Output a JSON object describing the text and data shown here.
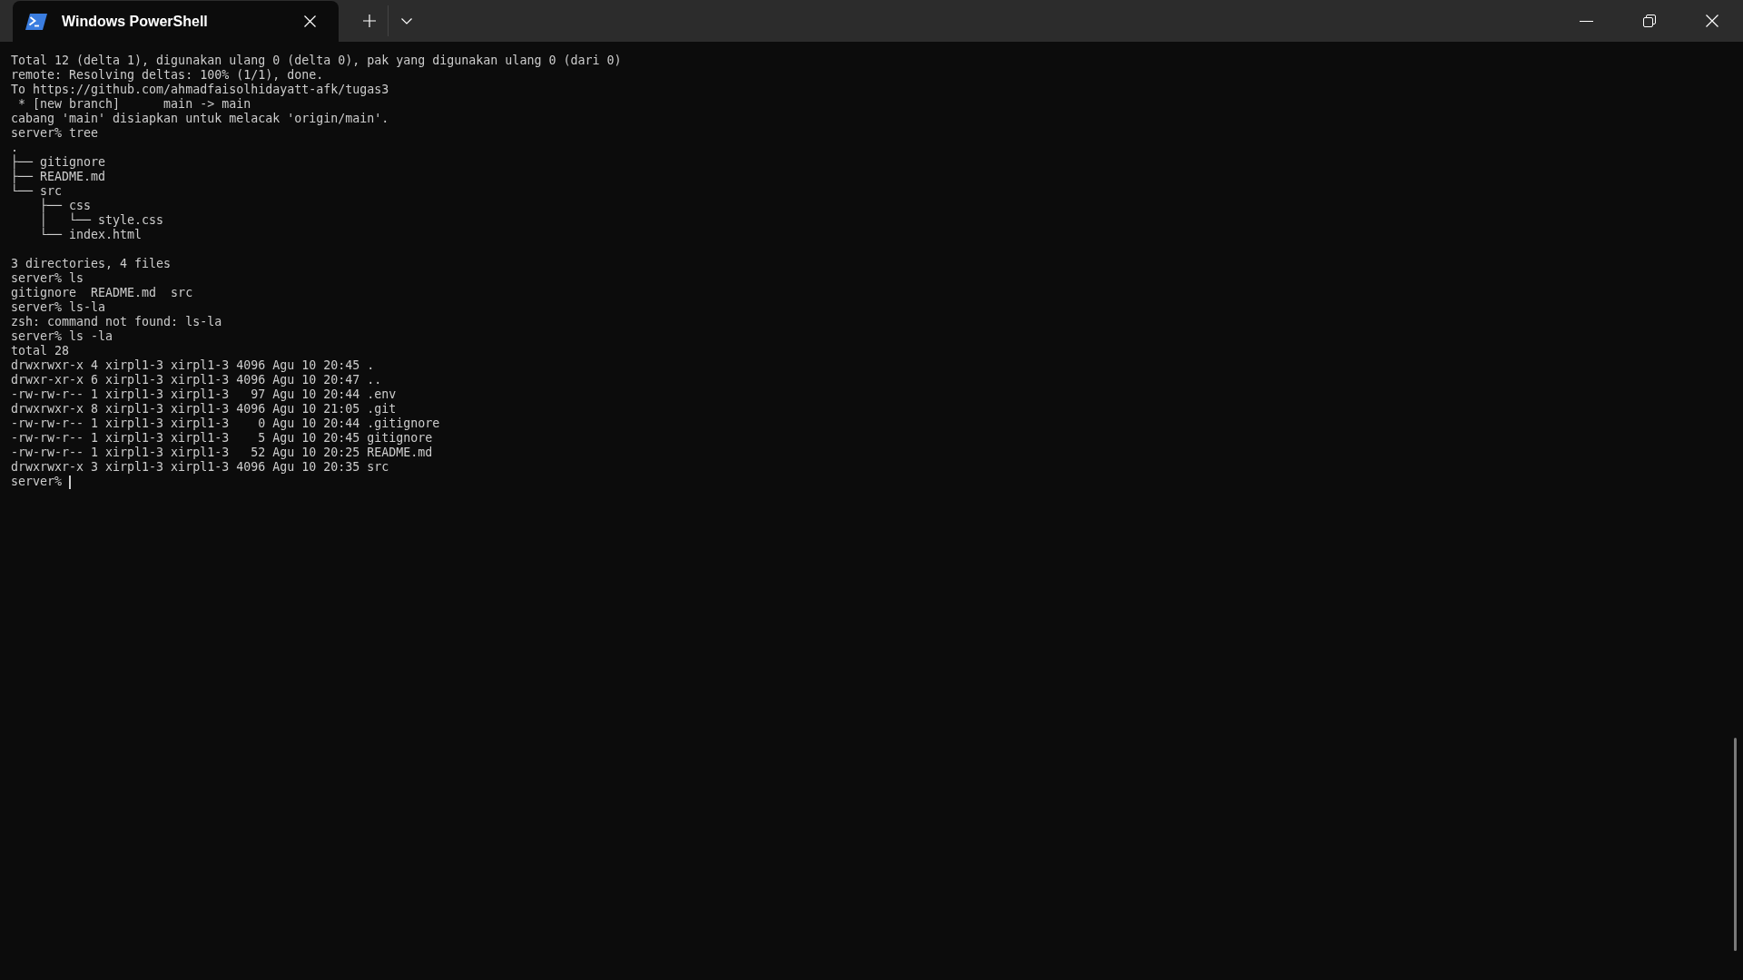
{
  "tabs": [
    {
      "label": "Windows PowerShell",
      "selected": true
    }
  ],
  "terminal": {
    "blocks": [
      [
        "Total 12 (delta 1), digunakan ulang 0 (delta 0), pak yang digunakan ulang 0 (dari 0)",
        "remote: Resolving deltas: 100% (1/1), done.",
        "To https://github.com/ahmadfaisolhidayatt-afk/tugas3",
        " * [new branch]      main -> main",
        "cabang 'main' disiapkan untuk melacak 'origin/main'.",
        "server% tree",
        ".",
        "├── gitignore",
        "├── README.md",
        "└── src",
        "    ├── css",
        "    │   └── style.css",
        "    └── index.html"
      ],
      [
        "3 directories, 4 files",
        "server% ls",
        "gitignore  README.md  src",
        "server% ls-la",
        "zsh: command not found: ls-la",
        "server% ls -la",
        "total 28",
        "drwxrwxr-x 4 xirpl1-3 xirpl1-3 4096 Agu 10 20:45 .",
        "drwxr-xr-x 6 xirpl1-3 xirpl1-3 4096 Agu 10 20:47 ..",
        "-rw-rw-r-- 1 xirpl1-3 xirpl1-3   97 Agu 10 20:44 .env",
        "drwxrwxr-x 8 xirpl1-3 xirpl1-3 4096 Agu 10 21:05 .git",
        "-rw-rw-r-- 1 xirpl1-3 xirpl1-3    0 Agu 10 20:44 .gitignore",
        "-rw-rw-r-- 1 xirpl1-3 xirpl1-3    5 Agu 10 20:45 gitignore",
        "-rw-rw-r-- 1 xirpl1-3 xirpl1-3   52 Agu 10 20:25 README.md",
        "drwxrwxr-x 3 xirpl1-3 xirpl1-3 4096 Agu 10 20:35 src",
        "server%"
      ]
    ],
    "cursor": true
  }
}
